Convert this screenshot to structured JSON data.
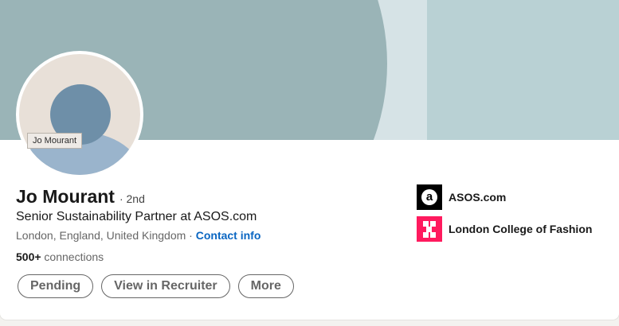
{
  "profile": {
    "name": "Jo Mourant",
    "degree": "· 2nd",
    "headline": "Senior Sustainability Partner at ASOS.com",
    "location": "London, England, United Kingdom",
    "location_sep": " · ",
    "contact_label": "Contact info",
    "connections_count": "500+",
    "connections_label": " connections",
    "avatar_tooltip": "Jo Mourant"
  },
  "actions": {
    "pending_label": "Pending",
    "recruiter_label": "View in Recruiter",
    "more_label": "More"
  },
  "organizations": [
    {
      "name": "ASOS.com",
      "logo_icon": "asos-logo-icon",
      "logo_color": "#000000"
    },
    {
      "name": "London College of Fashion",
      "logo_icon": "lcf-logo-icon",
      "logo_color": "#ff1a5e"
    }
  ],
  "colors": {
    "link": "#0a66c2",
    "banner_main": "#9ab4b7",
    "banner_light": "#d6e3e6",
    "banner_panel": "#b9d1d4"
  }
}
